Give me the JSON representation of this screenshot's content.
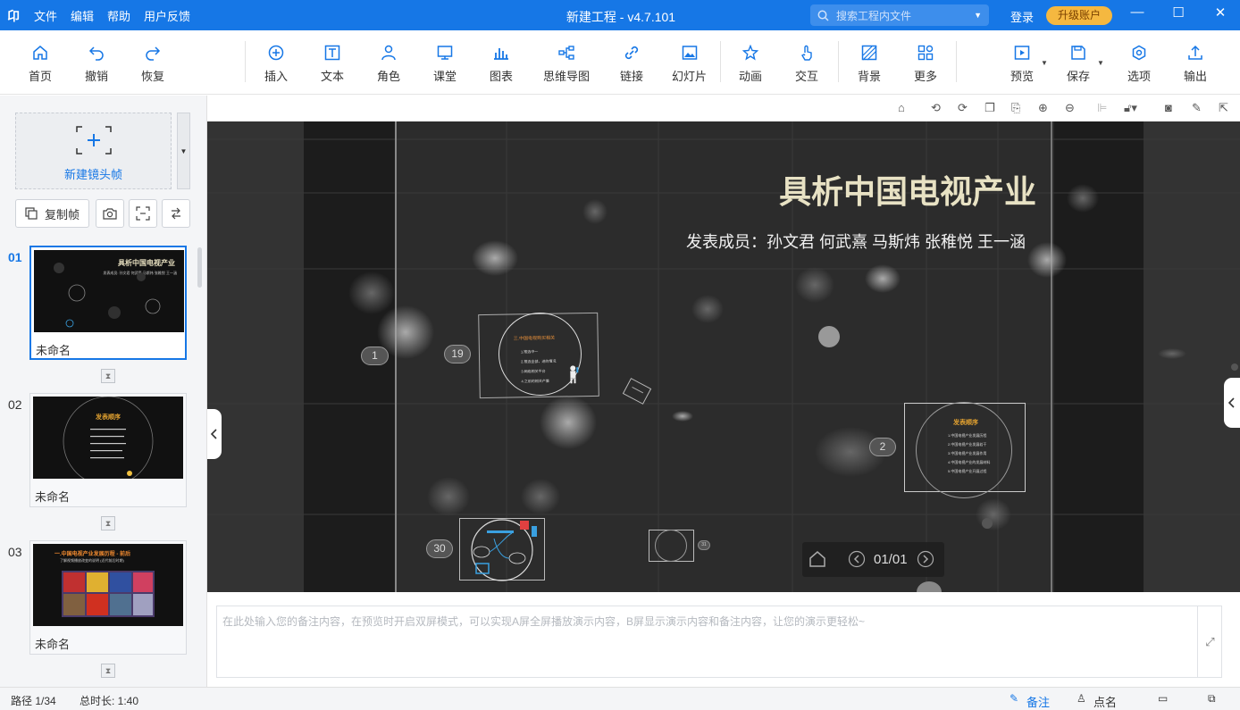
{
  "titlebar": {
    "logo": "卬",
    "menu": [
      "文件",
      "编辑",
      "帮助",
      "用户反馈"
    ],
    "title": "新建工程 - v4.7.101",
    "search_placeholder": "搜索工程内文件",
    "login": "登录",
    "upgrade": "升级账户"
  },
  "toolbar": {
    "items": [
      "首页",
      "撤销",
      "恢复",
      "插入",
      "文本",
      "角色",
      "课堂",
      "图表",
      "思维导图",
      "链接",
      "幻灯片",
      "动画",
      "交互",
      "背景",
      "更多",
      "预览",
      "保存",
      "选项",
      "输出"
    ]
  },
  "left": {
    "new_frame": "新建镜头帧",
    "copy_frame": "复制帧",
    "frames": [
      {
        "num": "01",
        "name": "未命名",
        "thumb_title": "具析中国电视产业",
        "thumb_sub": "发表成员: 孙文君 何武熹 马斯炜 张稚悦 王一涵"
      },
      {
        "num": "02",
        "name": "未命名",
        "thumb_title": "发表顺序"
      },
      {
        "num": "03",
        "name": "未命名",
        "thumb_title": "一.中国电视产业发展历程 - 前后",
        "thumb_sub": "了解视频播放改变的说明 (近代前后时期)"
      }
    ]
  },
  "stage": {
    "title": "具析中国电视产业",
    "members": "发表成员：孙文君 何武熹 马斯炜 张稚悦 王一涵",
    "badges": [
      "1",
      "19",
      "2",
      "30",
      "31"
    ],
    "frame19": {
      "title": "三.中国电视购买相关",
      "lines": [
        "1.推选中一",
        "2.推选全部，进的情况",
        "3.网络相关平台",
        "4.之前的相关产量"
      ]
    },
    "frame2": {
      "title": "发表顺序",
      "lines": [
        "1.中国电视产业发展历程",
        "2.中国电视产业发展若干",
        "3.中国电视产业发展作用",
        "4.中国电视产业的发展材料",
        "5.中国电视产业开展过程"
      ]
    },
    "pager": "01/01"
  },
  "notes_placeholder": "在此处输入您的备注内容，在预览时开启双屏模式，可以实现A屏全屏播放演示内容，B屏显示演示内容和备注内容，让您的演示更轻松~",
  "status": {
    "path": "路径 1/34",
    "duration": "总时长: 1:40",
    "notes": "备注",
    "points": "点名"
  }
}
